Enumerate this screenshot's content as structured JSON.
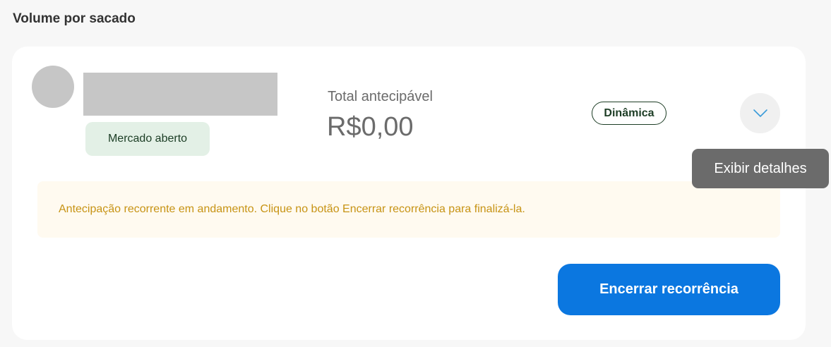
{
  "section": {
    "title": "Volume por sacado"
  },
  "payer": {
    "market_status": "Mercado aberto"
  },
  "total": {
    "label": "Total antecipável",
    "value": "R$0,00"
  },
  "type_badge": "Dinâmica",
  "expand_button": {
    "icon": "chevron-down-icon",
    "tooltip": "Exibir detalhes"
  },
  "notice": {
    "text": "Antecipação recorrente em andamento. Clique no botão Encerrar recorrência para finalizá-la."
  },
  "actions": {
    "end_recurrence_label": "Encerrar recorrência"
  },
  "colors": {
    "primary_button": "#0b77e0",
    "notice_text": "#c79314",
    "notice_bg": "#fffaf0",
    "badge_green_bg": "#e3f0e6",
    "badge_green_text": "#1b3d24",
    "tooltip_bg": "#6b6b6b"
  }
}
